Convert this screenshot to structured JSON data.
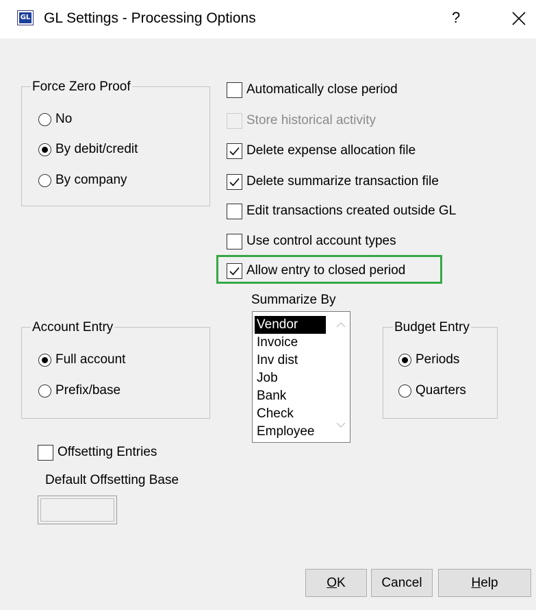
{
  "window": {
    "title": "GL Settings - Processing Options",
    "icon_text": "GL",
    "help_glyph": "?",
    "close_glyph": "✕"
  },
  "force_zero_proof": {
    "legend": "Force Zero Proof",
    "options": [
      {
        "label": "No",
        "selected": false
      },
      {
        "label": "By debit/credit",
        "selected": true
      },
      {
        "label": "By company",
        "selected": false
      }
    ]
  },
  "options": {
    "items": [
      {
        "label": "Automatically close period",
        "checked": false,
        "enabled": true
      },
      {
        "label": "Store historical activity",
        "checked": false,
        "enabled": false
      },
      {
        "label": "Delete expense allocation file",
        "checked": true,
        "enabled": true
      },
      {
        "label": "Delete summarize transaction file",
        "checked": true,
        "enabled": true
      },
      {
        "label": "Edit transactions created outside GL",
        "checked": false,
        "enabled": true
      },
      {
        "label": "Use control account types",
        "checked": false,
        "enabled": true
      },
      {
        "label": "Allow entry to closed period",
        "checked": true,
        "enabled": true
      }
    ]
  },
  "summarize_by": {
    "label": "Summarize By",
    "selected": "Vendor",
    "items": [
      "Vendor",
      "Invoice",
      "Inv dist",
      "Job",
      "Bank",
      "Check",
      "Employee"
    ]
  },
  "account_entry": {
    "legend": "Account Entry",
    "options": [
      {
        "label": "Full account",
        "selected": true
      },
      {
        "label": "Prefix/base",
        "selected": false
      }
    ]
  },
  "budget_entry": {
    "legend": "Budget Entry",
    "options": [
      {
        "label": "Periods",
        "selected": true
      },
      {
        "label": "Quarters",
        "selected": false
      }
    ]
  },
  "offsetting": {
    "checkbox_label": "Offsetting Entries",
    "checked": false,
    "base_label": "Default Offsetting Base",
    "base_value": ""
  },
  "buttons": {
    "ok": {
      "mnemonic": "O",
      "rest": "K"
    },
    "cancel": "Cancel",
    "help": {
      "mnemonic": "H",
      "rest": "elp"
    }
  },
  "colors": {
    "highlight": "#35a845",
    "window_bg": "#f0f0f0",
    "titlebar_bg": "#ffffff"
  }
}
